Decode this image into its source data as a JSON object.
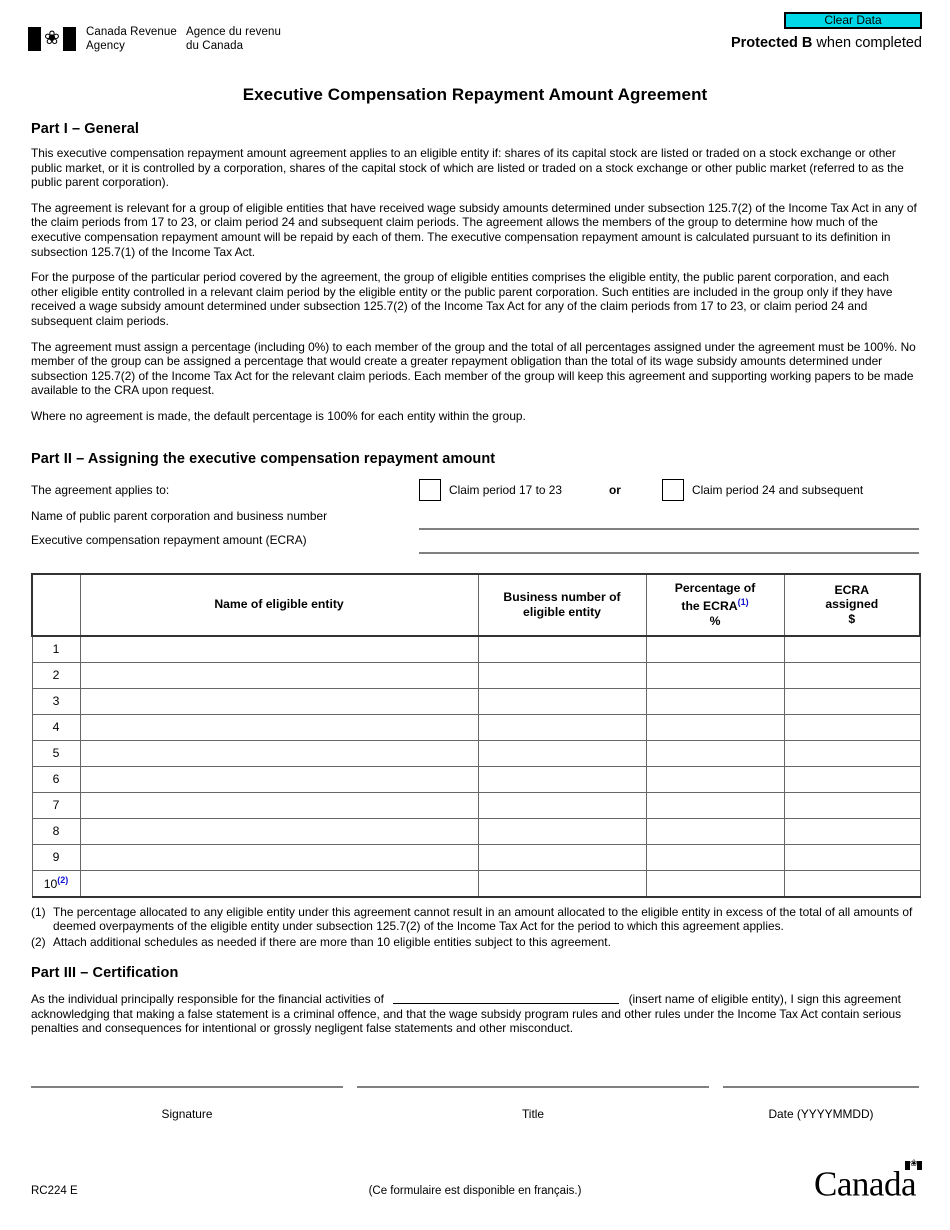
{
  "header": {
    "agency_en_line1": "Canada Revenue",
    "agency_en_line2": "Agency",
    "agency_fr_line1": "Agence du revenu",
    "agency_fr_line2": "du Canada",
    "clear_data_label": "Clear Data",
    "clear_data_bg": "#00D7E6",
    "protected_bold": "Protected B",
    "protected_rest": " when completed"
  },
  "title": "Executive Compensation Repayment Amount Agreement",
  "part1": {
    "heading": "Part I – General",
    "paragraphs": [
      "This executive compensation repayment amount agreement applies to an eligible entity if: shares of its capital stock are listed or traded on a stock exchange or other public market, or it is controlled by a corporation, shares of the capital stock of which are listed or traded on a stock exchange or other public market (referred to as the public parent corporation).",
      "The agreement is relevant for a group of eligible entities that have received wage subsidy amounts determined under subsection 125.7(2) of the Income Tax Act in any of the claim periods from 17 to 23, or claim period 24 and subsequent claim periods. The agreement allows the members of the group to determine how much of the executive compensation repayment amount will be repaid by each of them. The executive compensation repayment amount is calculated pursuant to its definition in subsection 125.7(1) of the Income Tax Act.",
      "For the purpose of the particular period covered by the agreement, the group of eligible entities comprises the eligible entity, the public parent corporation, and each other eligible entity controlled in a relevant claim period by the eligible entity or the public parent corporation.  Such entities are included in the group only if they have received a wage subsidy amount determined under subsection 125.7(2) of the Income Tax Act for any of the claim periods from 17 to 23, or claim period 24 and subsequent claim periods.",
      "The agreement must assign a percentage (including 0%) to each member of the group and the total of all percentages assigned under the agreement must be 100%. No member of the group can be assigned a percentage that would create a greater repayment obligation than the total of its wage subsidy amounts determined under subsection 125.7(2) of the Income Tax Act for the relevant claim periods. Each member of the group will keep this agreement and supporting working papers to be made available to the CRA upon request.",
      "Where no agreement is made, the default percentage is 100% for each entity within the group."
    ]
  },
  "part2": {
    "heading": "Part II – Assigning the executive compensation repayment amount",
    "applies_label": "The agreement applies to:",
    "checkbox1_label": "Claim period 17 to 23",
    "or_label": "or",
    "checkbox2_label": "Claim period 24 and subsequent",
    "field1_label": "Name of public parent corporation and business number",
    "field1_value": "",
    "field2_label": "Executive compensation repayment amount (ECRA)",
    "field2_value": "",
    "table": {
      "headers": {
        "rownum": "",
        "name": "Name of eligible entity",
        "bn_line1": "Business number of",
        "bn_line2": "eligible entity",
        "pct_line1": "Percentage of",
        "pct_line2": "the ECRA",
        "pct_sup": "(1)",
        "pct_line3": "%",
        "ecra_line1": "ECRA",
        "ecra_line2": "assigned",
        "ecra_line3": "$"
      },
      "rows": [
        {
          "num": "1",
          "sup": "",
          "name": "",
          "bn": "",
          "pct": "",
          "ecra": ""
        },
        {
          "num": "2",
          "sup": "",
          "name": "",
          "bn": "",
          "pct": "",
          "ecra": ""
        },
        {
          "num": "3",
          "sup": "",
          "name": "",
          "bn": "",
          "pct": "",
          "ecra": ""
        },
        {
          "num": "4",
          "sup": "",
          "name": "",
          "bn": "",
          "pct": "",
          "ecra": ""
        },
        {
          "num": "5",
          "sup": "",
          "name": "",
          "bn": "",
          "pct": "",
          "ecra": ""
        },
        {
          "num": "6",
          "sup": "",
          "name": "",
          "bn": "",
          "pct": "",
          "ecra": ""
        },
        {
          "num": "7",
          "sup": "",
          "name": "",
          "bn": "",
          "pct": "",
          "ecra": ""
        },
        {
          "num": "8",
          "sup": "",
          "name": "",
          "bn": "",
          "pct": "",
          "ecra": ""
        },
        {
          "num": "9",
          "sup": "",
          "name": "",
          "bn": "",
          "pct": "",
          "ecra": ""
        },
        {
          "num": "10",
          "sup": "(2)",
          "name": "",
          "bn": "",
          "pct": "",
          "ecra": ""
        }
      ]
    },
    "footnotes": [
      {
        "marker": "(1)",
        "text": "The percentage allocated to any eligible entity under this agreement cannot result in an amount allocated to the eligible entity in excess of the total of all amounts of deemed overpayments of the eligible entity under subsection 125.7(2) of the Income Tax Act for the period to which this agreement applies."
      },
      {
        "marker": "(2)",
        "text": "Attach additional schedules as needed if there are more than 10 eligible entities subject to this agreement."
      }
    ]
  },
  "part3": {
    "heading": "Part III – Certification",
    "text_before": "As the individual principally responsible for the financial activities of",
    "entity_value": "",
    "text_after": "(insert name of eligible entity), I sign this agreement acknowledging that making a false statement is a criminal offence, and that the wage subsidy program rules and other rules under the Income Tax Act contain serious penalties and consequences for intentional or grossly negligent false statements and other misconduct.",
    "signature_caption": "Signature",
    "signature_value": "",
    "title_caption": "Title",
    "title_value": "",
    "date_caption": "Date (YYYYMMDD)",
    "date_value": ""
  },
  "footer": {
    "form_code": "RC224 E",
    "french_note": "(Ce formulaire est disponible en français.)",
    "wordmark": "Canada"
  },
  "icons": {
    "maple_leaf": "❀"
  }
}
